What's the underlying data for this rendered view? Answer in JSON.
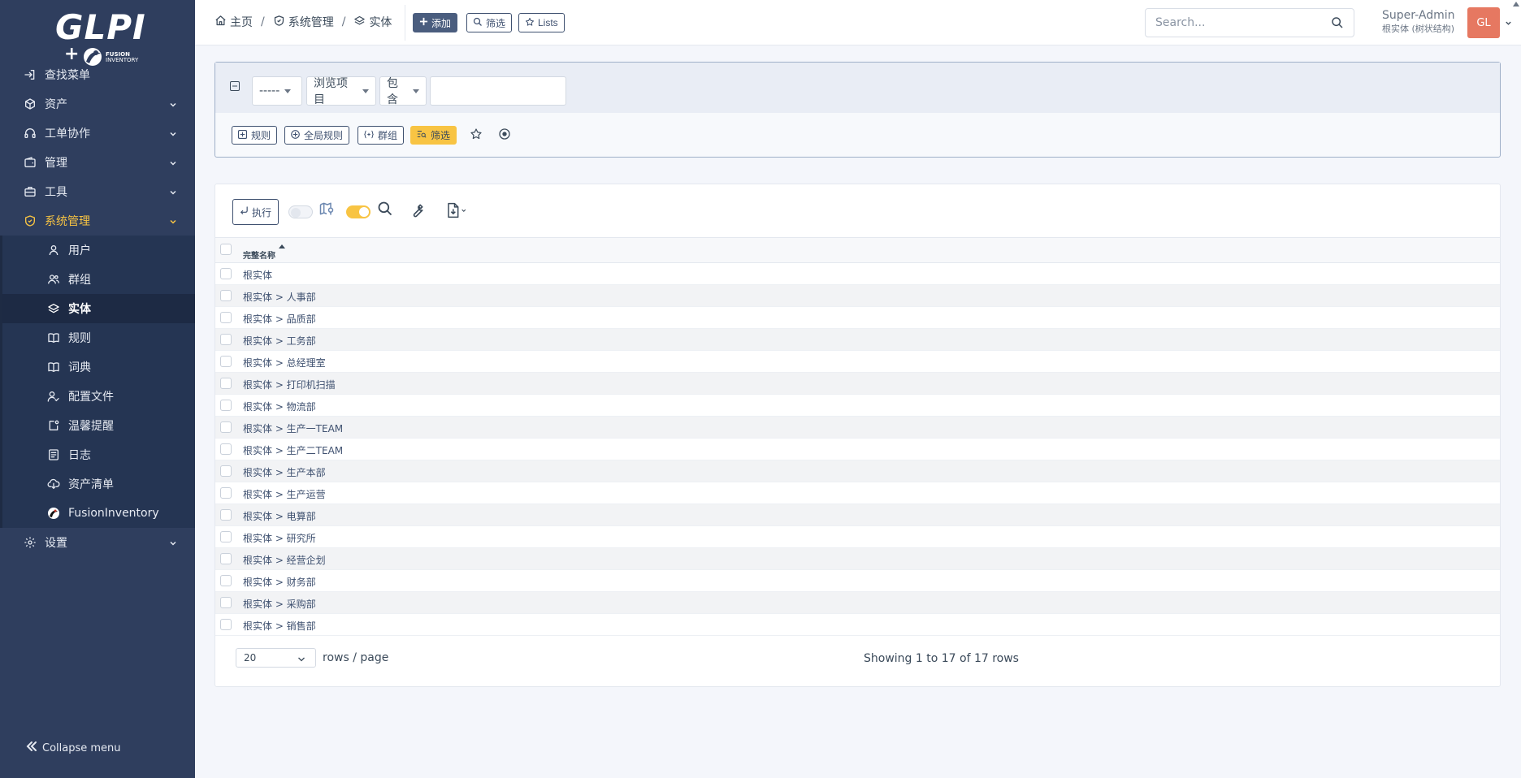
{
  "sidebar": {
    "logo": {
      "brand": "GLPI",
      "plus": "+",
      "addon_line1": "FUSION",
      "addon_line2": "INVENTORY"
    },
    "items": [
      {
        "label": "查找菜单",
        "icon": "arrow-right-to-bracket-icon"
      },
      {
        "label": "资产",
        "icon": "package-icon"
      },
      {
        "label": "工单协作",
        "icon": "headset-icon"
      },
      {
        "label": "管理",
        "icon": "wallet-icon"
      },
      {
        "label": "工具",
        "icon": "briefcase-icon"
      },
      {
        "label": "系统管理",
        "icon": "shield-check-icon"
      },
      {
        "label": "设置",
        "icon": "gear-icon"
      }
    ],
    "sub_items": [
      {
        "label": "用户",
        "icon": "user-icon"
      },
      {
        "label": "群组",
        "icon": "users-icon"
      },
      {
        "label": "实体",
        "icon": "stack-icon"
      },
      {
        "label": "规则",
        "icon": "book-icon"
      },
      {
        "label": "词典",
        "icon": "book-icon"
      },
      {
        "label": "配置文件",
        "icon": "user-check-icon"
      },
      {
        "label": "温馨提醒",
        "icon": "note-icon"
      },
      {
        "label": "日志",
        "icon": "log-icon"
      },
      {
        "label": "资产清单",
        "icon": "cloud-download-icon"
      },
      {
        "label": "FusionInventory",
        "icon": "fusioninventory-logo-icon"
      }
    ],
    "collapse_label": "Collapse menu"
  },
  "header": {
    "breadcrumb": [
      "主页",
      "系统管理",
      "实体"
    ],
    "buttons": {
      "add": "添加",
      "filter": "筛选",
      "lists": "Lists"
    },
    "search_placeholder": "Search...",
    "user_name": "Super-Admin",
    "user_entity": "根实体 (树状结构)",
    "avatar_initials": "GL"
  },
  "criteria": {
    "field": "-----",
    "scope": "浏览项目",
    "operator": "包含",
    "value": "",
    "buttons": {
      "rule": "规则",
      "global_rule": "全局规则",
      "group": "群组",
      "filter": "筛选"
    }
  },
  "results": {
    "execute_label": "执行",
    "column_header": "完整名称",
    "rows": [
      "根实体",
      "根实体 > 人事部",
      "根实体 > 品质部",
      "根实体 > 工务部",
      "根实体 > 总经理室",
      "根实体 > 打印机扫描",
      "根实体 > 物流部",
      "根实体 > 生产一TEAM",
      "根实体 > 生产二TEAM",
      "根实体 > 生产本部",
      "根实体 > 生产运营",
      "根实体 > 电算部",
      "根实体 > 研究所",
      "根实体 > 经营企划",
      "根实体 > 财务部",
      "根实体 > 采购部",
      "根实体 > 销售部"
    ],
    "page_size": "20",
    "rows_per_page_label": "rows / page",
    "showing_text": "Showing 1 to 17 of 17 rows"
  },
  "colors": {
    "sidebar": "#2f3e5e",
    "accent": "#f8c443",
    "primary": "#4a5d7e",
    "avatar": "#e46a50"
  }
}
